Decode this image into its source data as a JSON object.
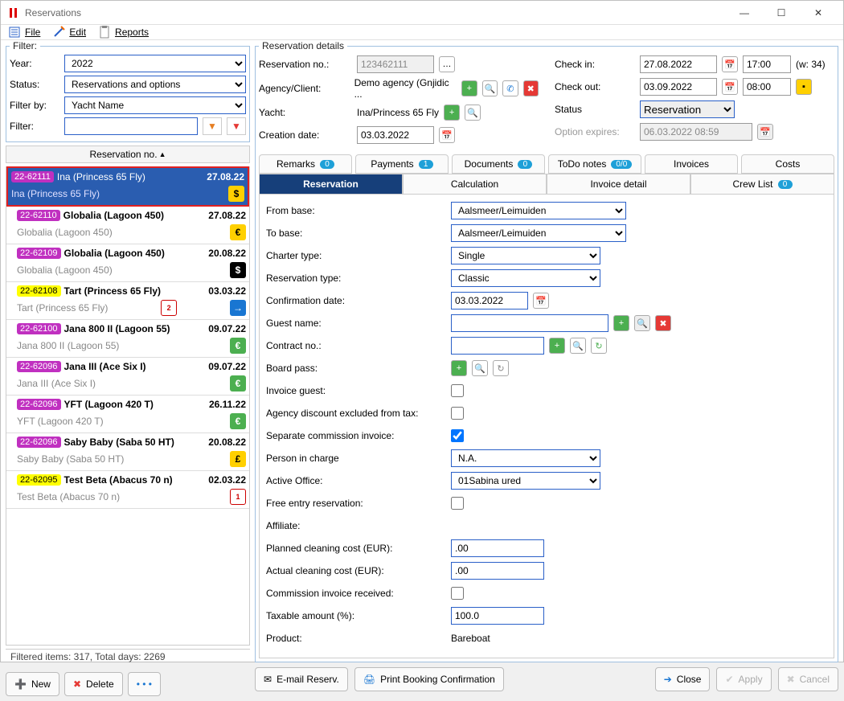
{
  "window": {
    "title": "Reservations"
  },
  "menu": {
    "file": "File",
    "edit": "Edit",
    "reports": "Reports"
  },
  "filter": {
    "legend": "Filter:",
    "year_label": "Year:",
    "year": "2022",
    "status_label": "Status:",
    "status": "Reservations and options",
    "filterby_label": "Filter by:",
    "filterby": "Yacht Name",
    "filter_label": "Filter:",
    "filter": ""
  },
  "list_header": "Reservation no.",
  "reservations": [
    {
      "id": "22-62111",
      "badge_color": "purple",
      "name": "Ina (Princess 65 Fly)",
      "date": "27.08.22",
      "yacht": "Ina (Princess 65 Fly)",
      "icons": [
        "dollar-y"
      ],
      "selected": true
    },
    {
      "id": "22-62110",
      "badge_color": "purple",
      "name": "Globalia (Lagoon 450)",
      "date": "27.08.22",
      "yacht": "Globalia (Lagoon 450)",
      "icons": [
        "euro-y"
      ]
    },
    {
      "id": "22-62109",
      "badge_color": "purple",
      "name": "Globalia (Lagoon 450)",
      "date": "20.08.22",
      "yacht": "Globalia (Lagoon 450)",
      "icons": [
        "dollar-b"
      ]
    },
    {
      "id": "22-62108",
      "badge_color": "yellow",
      "name": "Tart (Princess 65 Fly)",
      "date": "03.03.22",
      "yacht": "Tart (Princess 65 Fly)",
      "icons": [
        "cal",
        "arrow"
      ]
    },
    {
      "id": "22-62100",
      "badge_color": "purple",
      "name": "Jana 800 II (Lagoon 55)",
      "date": "09.07.22",
      "yacht": "Jana 800 II (Lagoon 55)",
      "icons": [
        "euro-g"
      ]
    },
    {
      "id": "22-62096",
      "badge_color": "purple",
      "name": "Jana III (Ace Six I)",
      "date": "09.07.22",
      "yacht": "Jana III (Ace Six I)",
      "icons": [
        "euro-g"
      ]
    },
    {
      "id": "22-62096",
      "badge_color": "purple",
      "name": "YFT (Lagoon 420 T)",
      "date": "26.11.22",
      "yacht": "YFT (Lagoon 420 T)",
      "icons": [
        "euro-g"
      ]
    },
    {
      "id": "22-62096",
      "badge_color": "purple",
      "name": "Saby Baby (Saba 50 HT)",
      "date": "20.08.22",
      "yacht": "Saby Baby (Saba 50 HT)",
      "icons": [
        "pound-y"
      ]
    },
    {
      "id": "22-62095",
      "badge_color": "yellow",
      "name": "Test Beta (Abacus 70 n)",
      "date": "02.03.22",
      "yacht": "Test Beta (Abacus 70 n)",
      "icons": [
        "cal1"
      ]
    }
  ],
  "list_status": "Filtered items:  317,  Total days:  2269",
  "buttons": {
    "new": "New",
    "delete": "Delete",
    "email": "E-mail Reserv.",
    "print": "Print Booking Confirmation",
    "close": "Close",
    "apply": "Apply",
    "cancel": "Cancel"
  },
  "details": {
    "legend": "Reservation details",
    "resno_label": "Reservation no.:",
    "resno": "123462111",
    "agency_label": "Agency/Client:",
    "agency": "Demo agency (Gnjidic ...",
    "yacht_label": "Yacht:",
    "yacht": "Ina/Princess 65 Fly",
    "creation_label": "Creation date:",
    "creation": "03.03.2022",
    "checkin_label": "Check in:",
    "checkin_date": "27.08.2022",
    "checkin_time": "17:00",
    "week": "(w: 34)",
    "checkout_label": "Check out:",
    "checkout_date": "03.09.2022",
    "checkout_time": "08:00",
    "status_label": "Status",
    "status": "Reservation",
    "expires_label": "Option expires:",
    "expires": "06.03.2022 08:59"
  },
  "tabs_upper": {
    "remarks": "Remarks",
    "remarks_n": "0",
    "payments": "Payments",
    "payments_n": "1",
    "documents": "Documents",
    "documents_n": "0",
    "todo": "ToDo notes",
    "todo_n": "0/0",
    "invoices": "Invoices",
    "costs": "Costs"
  },
  "tabs_lower": {
    "reservation": "Reservation",
    "calculation": "Calculation",
    "invoice": "Invoice detail",
    "crew": "Crew List",
    "crew_n": "0"
  },
  "form": {
    "from_base_label": "From base:",
    "from_base": "Aalsmeer/Leimuiden",
    "to_base_label": "To base:",
    "to_base": "Aalsmeer/Leimuiden",
    "charter_label": "Charter type:",
    "charter": "Single",
    "rtype_label": "Reservation type:",
    "rtype": "Classic",
    "confirm_label": "Confirmation date:",
    "confirm": "03.03.2022",
    "guest_label": "Guest name:",
    "guest": "",
    "contract_label": "Contract no.:",
    "contract": "",
    "board_label": "Board pass:",
    "invoice_guest_label": "Invoice guest:",
    "agency_disc_label": "Agency discount excluded from tax:",
    "sep_comm_label": "Separate commission invoice:",
    "person_label": "Person in charge",
    "person": "N.A.",
    "office_label": "Active Office:",
    "office": "01Sabina ured",
    "free_label": "Free entry reservation:",
    "affiliate_label": "Affiliate:",
    "planned_label": "Planned cleaning cost (EUR):",
    "planned": ".00",
    "actual_label": "Actual cleaning cost (EUR):",
    "actual": ".00",
    "comm_recv_label": "Commission invoice received:",
    "taxable_label": "Taxable amount (%):",
    "taxable": "100.0",
    "product_label": "Product:",
    "product": "Bareboat"
  }
}
